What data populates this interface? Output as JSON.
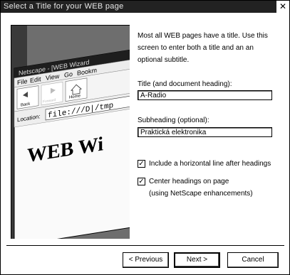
{
  "window": {
    "title": "Select a Title for your WEB page",
    "close_glyph": "✕"
  },
  "illustration": {
    "browser_title": "Netscape - [WEB Wizard",
    "menu": [
      "File",
      "Edit",
      "View",
      "Go",
      "Bookm"
    ],
    "toolbar": [
      "Back",
      "Forward",
      "Home"
    ],
    "location_label": "Location:",
    "location_value": "file:///D|/tmp",
    "heading": "WEB Wi"
  },
  "intro_text": "Most all WEB pages have a title. Use this screen to enter both a title and an an optional subtitle.",
  "title_field": {
    "label": "Title (and document heading):",
    "value": "A-Radio"
  },
  "subheading_field": {
    "label": "Subheading (optional):",
    "value": "Praktická elektronika"
  },
  "options": {
    "horizontal_line": {
      "label": "Include a horizontal line after headings",
      "checked": true
    },
    "center_headings": {
      "label": "Center headings on page",
      "sublabel": "(using NetScape enhancements)",
      "checked": true
    }
  },
  "buttons": {
    "previous": "< Previous",
    "next": "Next >",
    "cancel": "Cancel"
  },
  "check_glyph": "✓"
}
